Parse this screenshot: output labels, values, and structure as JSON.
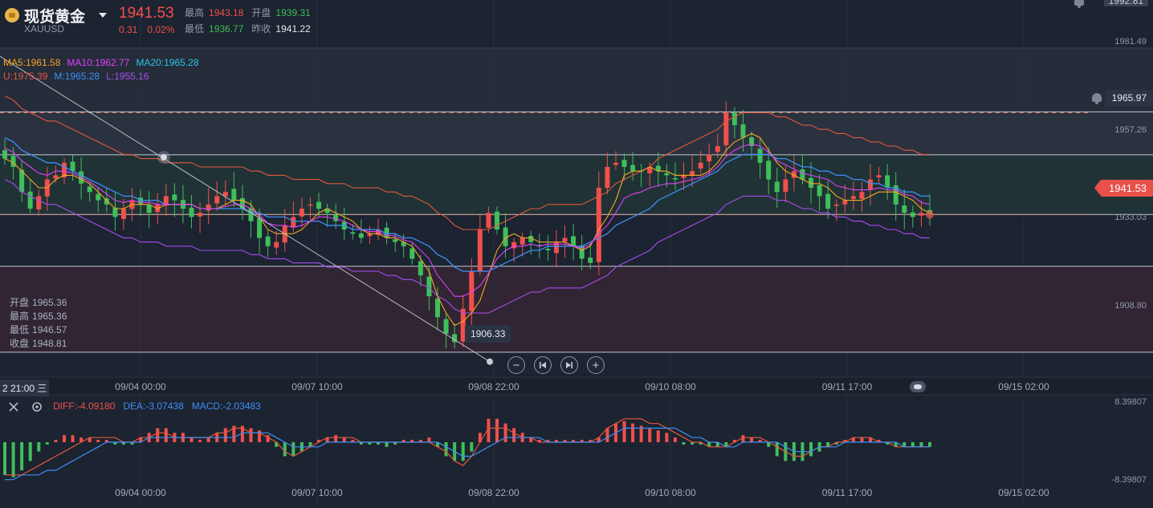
{
  "header": {
    "title": "现货黄金",
    "symbol": "XAUUSD",
    "price": "1941.53",
    "change": "0.31",
    "change_pct": "0.02%",
    "high_label": "最高",
    "high": "1943.18",
    "open_label": "开盘",
    "open": "1939.31",
    "low_label": "最低",
    "low": "1936.77",
    "prev_close_label": "昨收",
    "prev_close": "1941.22"
  },
  "legends": {
    "ma5": "MA5:1961.58",
    "ma10": "MA10:1962.77",
    "ma20": "MA20:1965.28",
    "boll_u": "U:1975.39",
    "boll_m": "M:1965.28",
    "boll_l": "L:1955.16"
  },
  "ohlc_box": {
    "open_label": "开盘",
    "open": "1965.36",
    "high_label": "最高",
    "high": "1965.36",
    "low_label": "最低",
    "low": "1946.57",
    "close_label": "收盘",
    "close": "1948.81"
  },
  "price_axis": {
    "top_tag": "1992.81",
    "ticks": [
      "1981.49",
      "1957.26",
      "1933.03",
      "1908.80"
    ],
    "alert_tag": "1965.97",
    "last_tag": "1941.53"
  },
  "annotations": {
    "low_tag": "1906.33"
  },
  "time_axis": {
    "cursor_tag": "2 21:00 三",
    "labels": [
      "09/04 00:00",
      "09/07 10:00",
      "09/08 22:00",
      "09/10 08:00",
      "09/11 17:00",
      "09/15 02:00"
    ]
  },
  "macd": {
    "diff": "DIFF:-4.09180",
    "dea": "DEA:-3.07438",
    "macd": "MACD:-2.03483",
    "axis_top": "8.39807",
    "axis_bottom": "-8.39807"
  },
  "nav": {
    "zoom_out": "−",
    "zoom_in": "+"
  },
  "colors": {
    "up": "#f0504b",
    "down": "#3fbf5a",
    "ma5": "#f5a623",
    "ma10": "#e040fb",
    "ma20": "#2ec4e6",
    "boll_u": "#e2583e",
    "boll_m": "#3d8ff5",
    "boll_l": "#a64df0",
    "diff": "#e2583e",
    "dea": "#3d8ff5"
  },
  "chart_data": [
    {
      "type": "candlestick",
      "title": "现货黄金 XAUUSD",
      "x_labels": [
        "09/04 00:00",
        "09/07 10:00",
        "09/08 22:00",
        "09/10 08:00",
        "09/11 17:00",
        "09/15 02:00"
      ],
      "y_ticks": [
        1908.8,
        1933.03,
        1957.26,
        1981.49
      ],
      "ylim": [
        1903,
        1993
      ],
      "horizontal_levels": [
        1981.49,
        1966.2,
        1955.9,
        1941.6,
        1929.2,
        1908.6
      ],
      "alert_level": 1965.97,
      "last_price": 1941.53,
      "trendline": {
        "from": 1973.5,
        "to": 1906.33
      },
      "series": [
        {
          "name": "Close",
          "values": [
            1955,
            1953,
            1947,
            1943,
            1946,
            1950,
            1951,
            1954,
            1952,
            1949,
            1947,
            1945,
            1944,
            1941,
            1943,
            1945,
            1944,
            1942,
            1944,
            1946,
            1945,
            1943,
            1941,
            1942,
            1944,
            1946,
            1947,
            1945,
            1943,
            1940,
            1936,
            1934,
            1935,
            1939,
            1941,
            1943,
            1944,
            1943,
            1942,
            1940,
            1938,
            1937,
            1936,
            1937,
            1938,
            1936,
            1935,
            1934,
            1931,
            1927,
            1922,
            1917,
            1913,
            1911,
            1919,
            1928,
            1938,
            1942,
            1938,
            1934,
            1935,
            1936,
            1935,
            1934,
            1933,
            1935,
            1936,
            1934,
            1931,
            1930,
            1948,
            1953,
            1954,
            1953,
            1952,
            1952,
            1953,
            1952,
            1951,
            1950,
            1951,
            1952,
            1954,
            1956,
            1958,
            1966,
            1963,
            1960,
            1958,
            1954,
            1950,
            1947,
            1950,
            1952,
            1950,
            1948,
            1946,
            1943,
            1944,
            1945,
            1946,
            1947,
            1950,
            1951,
            1948,
            1944,
            1942,
            1941,
            1942,
            1941.53
          ]
        },
        {
          "name": "MA5",
          "values": [
            1955,
            1954,
            1952,
            1950,
            1948,
            1948,
            1950,
            1951,
            1951,
            1950,
            1949,
            1947,
            1945,
            1943,
            1943,
            1944,
            1944,
            1944,
            1943,
            1944,
            1944,
            1944,
            1944,
            1943,
            1943,
            1943,
            1944,
            1945,
            1945,
            1944,
            1941,
            1938,
            1937,
            1937,
            1937,
            1938,
            1940,
            1942,
            1943,
            1942,
            1941,
            1940,
            1938,
            1937,
            1937,
            1936,
            1936,
            1935,
            1934,
            1931,
            1928,
            1922,
            1918,
            1915,
            1916,
            1918,
            1921,
            1927,
            1933,
            1936,
            1937,
            1936,
            1936,
            1935,
            1935,
            1935,
            1935,
            1934,
            1933,
            1934,
            1938,
            1941,
            1945,
            1951,
            1952,
            1952,
            1953,
            1952,
            1952,
            1951,
            1951,
            1951,
            1951,
            1952,
            1954,
            1957,
            1959,
            1960,
            1961,
            1960,
            1957,
            1954,
            1952,
            1951,
            1950,
            1949,
            1949,
            1948,
            1946,
            1945,
            1945,
            1945,
            1946,
            1947,
            1947,
            1947,
            1946,
            1945,
            1943,
            1942
          ]
        },
        {
          "name": "MA20",
          "values": [
            1960,
            1959,
            1957,
            1956,
            1955,
            1954,
            1954,
            1953,
            1952,
            1951,
            1950,
            1949,
            1948,
            1947,
            1946,
            1946,
            1945,
            1945,
            1945,
            1944,
            1944,
            1944,
            1944,
            1943,
            1943,
            1943,
            1943,
            1943,
            1943,
            1942,
            1942,
            1941,
            1941,
            1941,
            1940,
            1940,
            1940,
            1940,
            1939,
            1939,
            1939,
            1938,
            1938,
            1938,
            1938,
            1937,
            1937,
            1936,
            1936,
            1935,
            1934,
            1932,
            1931,
            1929,
            1928,
            1928,
            1928,
            1928,
            1929,
            1930,
            1931,
            1932,
            1933,
            1933,
            1934,
            1934,
            1934,
            1934,
            1934,
            1935,
            1936,
            1937,
            1939,
            1940,
            1941,
            1942,
            1943,
            1945,
            1946,
            1947,
            1948,
            1949,
            1950,
            1951,
            1952,
            1954,
            1955,
            1956,
            1956,
            1956,
            1956,
            1955,
            1955,
            1954,
            1953,
            1953,
            1952,
            1952,
            1951,
            1951,
            1950,
            1950,
            1949,
            1949,
            1948,
            1948,
            1947,
            1947,
            1946,
            1946
          ]
        }
      ]
    },
    {
      "type": "bar",
      "title": "MACD",
      "ylim": [
        -8.39807,
        8.39807
      ],
      "series": [
        {
          "name": "MACD",
          "values": [
            -7,
            -7.5,
            -6,
            -4,
            -2,
            -0.5,
            0.5,
            1.5,
            1.5,
            1,
            1,
            0.5,
            0.5,
            -0.5,
            -0.5,
            -0.5,
            1,
            2,
            3,
            3,
            2,
            2,
            1,
            0.5,
            1,
            2,
            3,
            3.5,
            3.5,
            3,
            2.5,
            1.5,
            -1,
            -3,
            -3,
            -2,
            -1,
            0.5,
            1,
            1.5,
            1,
            0.5,
            -0.5,
            -0.5,
            -0.5,
            -1,
            -0.5,
            0.5,
            0.5,
            0.5,
            1,
            -1,
            -3,
            -4,
            -4,
            -2,
            2,
            5,
            5,
            4,
            3,
            2,
            1,
            0.5,
            0.5,
            0.5,
            0.5,
            0.5,
            0.5,
            0.5,
            1,
            3,
            4,
            4.5,
            4,
            3.5,
            3,
            2.5,
            2,
            1,
            -0.5,
            -0.5,
            -0.5,
            -1,
            -1,
            -1,
            0.5,
            1.5,
            1,
            0.5,
            -1,
            -3,
            -4,
            -4,
            -4,
            -3,
            -2,
            -1,
            -0.5,
            0.5,
            1,
            1,
            1,
            0.5,
            -0.5,
            -1,
            -1,
            -1,
            -1,
            -1
          ]
        },
        {
          "name": "DIFF",
          "values": [
            -7,
            -7,
            -7,
            -6,
            -5,
            -4,
            -3,
            -2,
            -1,
            0,
            1,
            1,
            1,
            1,
            0,
            0,
            1,
            1,
            2,
            2,
            1,
            1,
            1,
            1,
            1,
            2,
            2,
            3,
            3,
            2,
            2,
            1,
            0,
            -2,
            -3,
            -2,
            -1,
            0,
            1,
            1,
            1,
            1,
            0,
            0,
            0,
            0,
            0,
            0,
            0,
            0,
            0,
            -1,
            -2,
            -4,
            -5,
            -3,
            0,
            3,
            3,
            3,
            2,
            1,
            1,
            0,
            0,
            0,
            0,
            0,
            0,
            0,
            1,
            3,
            4,
            5,
            5,
            5,
            4,
            4,
            3,
            2,
            1,
            0,
            0,
            -1,
            -1,
            -1,
            0,
            1,
            1,
            1,
            0,
            -1,
            -2,
            -3,
            -3,
            -2,
            -1,
            -1,
            0,
            0,
            1,
            1,
            1,
            0,
            0,
            -1,
            -1,
            -1,
            -1,
            -1
          ]
        },
        {
          "name": "DEA",
          "values": [
            -8,
            -8,
            -7,
            -7,
            -7,
            -6,
            -6,
            -5,
            -4,
            -3,
            -2,
            -1,
            0,
            0,
            0,
            0,
            0,
            1,
            1,
            1,
            1,
            1,
            1,
            1,
            1,
            1,
            1,
            1,
            2,
            2,
            2,
            2,
            1,
            0,
            -1,
            -1,
            -1,
            -1,
            0,
            0,
            0,
            0,
            0,
            0,
            0,
            0,
            0,
            0,
            0,
            0,
            0,
            0,
            -1,
            -2,
            -3,
            -3,
            -2,
            -1,
            0,
            1,
            1,
            1,
            1,
            1,
            0,
            0,
            0,
            0,
            0,
            0,
            0,
            1,
            2,
            3,
            3,
            3,
            3,
            3,
            3,
            3,
            2,
            1,
            1,
            0,
            0,
            -1,
            -1,
            0,
            0,
            0,
            0,
            0,
            -1,
            -2,
            -2,
            -2,
            -1,
            -1,
            -1,
            0,
            0,
            0,
            0,
            0,
            0,
            0,
            -1,
            -1,
            -1,
            -1
          ]
        }
      ]
    }
  ]
}
